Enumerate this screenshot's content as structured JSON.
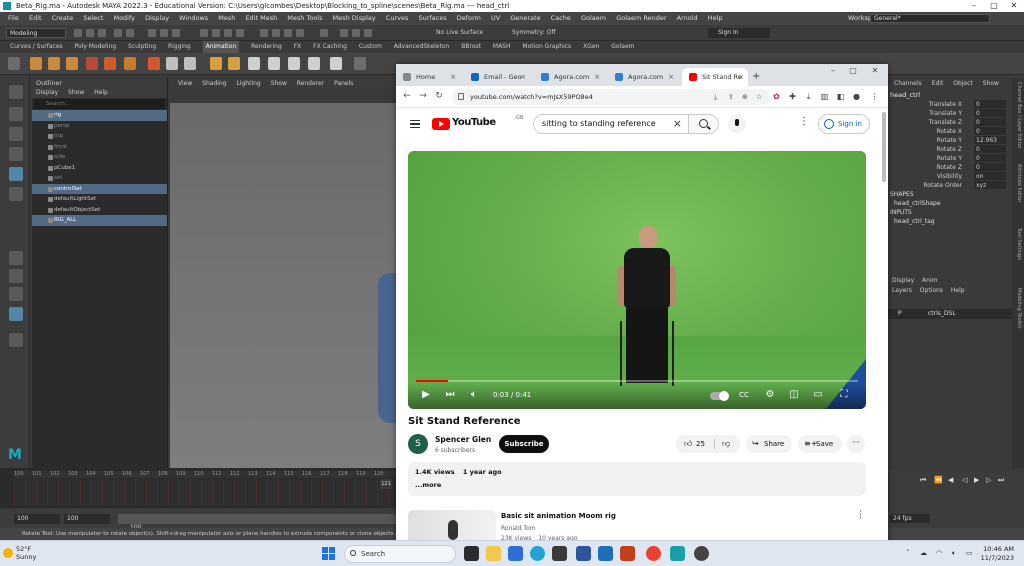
{
  "maya": {
    "title": "Beta_Rig.ma - Autodesk MAYA 2022.3 - Educational Version: C:\\Users\\glcombes\\Desktop\\Blocking_to_spline\\scenes\\Beta_Rig.ma --- head_ctrl",
    "menu": [
      "File",
      "Edit",
      "Create",
      "Select",
      "Modify",
      "Display",
      "Windows",
      "Mesh",
      "Edit Mesh",
      "Mesh Tools",
      "Mesh Display",
      "Curves",
      "Surfaces",
      "Deform",
      "UV",
      "Generate",
      "Cache",
      "Golaem",
      "Golaem Render",
      "Arnold",
      "Help"
    ],
    "workspace_label": "Workspace :",
    "workspace_value": "General*",
    "mode": "Modeling",
    "live_surface": "No Live Surface",
    "symmetry": "Symmetry: Off",
    "sign_in": "Sign In",
    "shelf_tabs": [
      "Curves / Surfaces",
      "Poly Modeling",
      "Sculpting",
      "Rigging",
      "Animation",
      "Rendering",
      "FX",
      "FX Caching",
      "Custom",
      "AdvancedSkeleton",
      "BBrost",
      "MASH",
      "Motion Graphics",
      "XGen",
      "Golaem"
    ],
    "active_shelf": "Animation",
    "outliner": {
      "title": "Outliner",
      "menu": [
        "Display",
        "Show",
        "Help"
      ],
      "search_placeholder": "Search...",
      "items": [
        {
          "label": "rig",
          "state": "sel"
        },
        {
          "label": "persp",
          "state": "dim"
        },
        {
          "label": "top",
          "state": "dim"
        },
        {
          "label": "front",
          "state": "dim"
        },
        {
          "label": "side",
          "state": "dim"
        },
        {
          "label": "pCube1",
          "state": ""
        },
        {
          "label": "set",
          "state": "dim"
        },
        {
          "label": "controlSet",
          "state": "sel"
        },
        {
          "label": "defaultLightSet",
          "state": ""
        },
        {
          "label": "defaultObjectSet",
          "state": ""
        },
        {
          "label": "RIG_ALL",
          "state": "sel"
        }
      ]
    },
    "viewport_menu": [
      "View",
      "Shading",
      "Lighting",
      "Show",
      "Renderer",
      "Panels"
    ],
    "timeline_ticks": [
      "100",
      "101",
      "102",
      "103",
      "104",
      "105",
      "106",
      "107",
      "108",
      "109",
      "110",
      "111",
      "112",
      "113",
      "114",
      "115",
      "116",
      "117",
      "118",
      "119",
      "120"
    ],
    "current_frame": "121",
    "range_start": "100",
    "range_inner": "100",
    "range_label": "100",
    "help_line": "Rotate Tool: Use manipulator to rotate object(s). Shift+drag manipulator axis or plane handles to extrude components or clone objects. Ctrl+Shift+LMB+drag to constrain rotation",
    "channel_box": {
      "menu": [
        "Channels",
        "Edit",
        "Object",
        "Show"
      ],
      "object": "head_ctrl",
      "attributes": [
        {
          "name": "Translate X",
          "value": "0"
        },
        {
          "name": "Translate Y",
          "value": "0"
        },
        {
          "name": "Translate Z",
          "value": "0"
        },
        {
          "name": "Rotate X",
          "value": "0"
        },
        {
          "name": "Rotate Y",
          "value": "12.963"
        },
        {
          "name": "Rotate Z",
          "value": "0"
        },
        {
          "name": "Rotate Y",
          "value": "0"
        },
        {
          "name": "Rotate Z",
          "value": "0"
        },
        {
          "name": "Visibility",
          "value": "on"
        },
        {
          "name": "Rotate Order",
          "value": "xyz"
        }
      ],
      "shapes_label": "SHAPES",
      "shape": "head_ctrlShape",
      "inputs_label": "INPUTS",
      "input": "head_ctrl_tag",
      "layer_tabs": [
        "Display",
        "Anim"
      ],
      "layer_menu": [
        "Layers",
        "Options",
        "Help"
      ],
      "layer_row": {
        "p": "P",
        "name": "ctrls_DSL"
      },
      "side_tabs": [
        "Channel Box / Layer Editor",
        "Attribute Editor",
        "Tool Settings",
        "Modeling Toolkit"
      ]
    },
    "fps": "24 fps"
  },
  "chrome": {
    "tabs": [
      {
        "label": "Home",
        "color": "#888888",
        "active": false
      },
      {
        "label": "Email - Geo",
        "color": "#0a66c2",
        "active": false
      },
      {
        "label": "Agora.com",
        "color": "#2f7fd1",
        "active": false
      },
      {
        "label": "Agora.com",
        "color": "#2f7fd1",
        "active": false
      },
      {
        "label": "Sit Stand Re",
        "color": "#ff0000",
        "active": true
      }
    ],
    "url": "youtube.com/watch?v=mJsX59PO8e4"
  },
  "youtube": {
    "logo_text": "YouTube",
    "country": "GB",
    "search_value": "sitting to standing reference",
    "sign_in": "Sign in",
    "video": {
      "time_current": "0:03",
      "time_total": "0:41",
      "time_text": "0:03 / 0:41",
      "progress": 0.073
    },
    "title": "Sit Stand Reference",
    "channel": {
      "initial": "S",
      "name": "Spencer Glen",
      "subscribers": "6 subscribers"
    },
    "subscribe": "Subscribe",
    "likes": "25",
    "share": "Share",
    "save": "Save",
    "views": "1.4K views",
    "age": "1 year ago",
    "more": "...more",
    "recommendation": {
      "title": "Basic sit animation Moom rig",
      "channel": "Ronald Tom",
      "views": "23K views",
      "age": "10 years ago"
    }
  },
  "taskbar": {
    "temp": "52°F",
    "condition": "Sunny",
    "search": "Search",
    "time": "10:46 AM",
    "date": "11/7/2023"
  }
}
